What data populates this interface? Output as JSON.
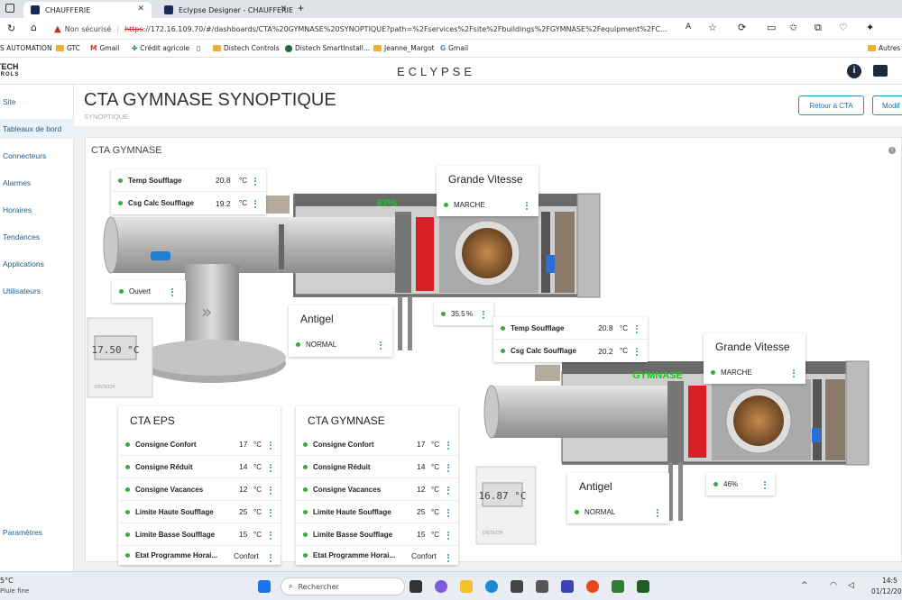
{
  "browser": {
    "tabs": [
      {
        "label": "CHAUFFERIE"
      },
      {
        "label": "Eclypse Designer - CHAUFFERIE"
      }
    ],
    "security_label": "Non sécurisé",
    "url_scheme": "https",
    "url_rest": "://172.16.109.70/#/dashboards/CTA%20GYMNASE%20SYNOPTIQUE?path=%2Fservices%2Fsite%2Fbuildings%2FGYMNASE%2Fequipment%2FC...",
    "bookmarks": [
      "S AUTOMATION",
      "GTC",
      "Gmail",
      "Crédit agricole",
      "Distech Controls",
      "Distech SmartInstall...",
      "Jeanne_Margot",
      "Gmail"
    ],
    "other_bookmarks": "Autres"
  },
  "app": {
    "brand_line1": "TECH",
    "brand_line2": "TROLS",
    "logo": "ECLYPSE"
  },
  "sidebar": {
    "items": [
      "Site",
      "Tableaux de bord",
      "Connecteurs",
      "Alarmes",
      "Horaires",
      "Tendances",
      "Applications",
      "Utilisateurs"
    ],
    "bottom": "Paramètres"
  },
  "page": {
    "title": "CTA GYMNASE SYNOPTIQUE",
    "subtitle": "SYNOPTIQUE",
    "back_button": "Retour à CTA",
    "modify_button": "Modif"
  },
  "content": {
    "title": "CTA GYMNASE",
    "info_icon": "info-icon",
    "eps_label": "EPS",
    "gymnase_label": "GYMNASE",
    "thermostat1": "17.50 °C",
    "thermostat2": "16.87 °C",
    "brand_small": "DISTECH"
  },
  "top_card": {
    "rows": [
      {
        "label": "Temp Soufflage",
        "value": "20.8",
        "unit": "°C"
      },
      {
        "label": "Csg Calc Soufflage",
        "value": "19.2",
        "unit": "°C"
      }
    ]
  },
  "ouvert_card": {
    "value": "Ouvert"
  },
  "gv1": {
    "title": "Grande Vitesse",
    "value": "MARCHE"
  },
  "antigel1": {
    "title": "Antigel",
    "value": "NORMAL"
  },
  "valve1": {
    "value": "35.5",
    "unit": "%"
  },
  "mid_card": {
    "rows": [
      {
        "label": "Temp Soufflage",
        "value": "20.8",
        "unit": "°C"
      },
      {
        "label": "Csg Calc Soufflage",
        "value": "20.2",
        "unit": "°C"
      }
    ]
  },
  "gv2": {
    "title": "Grande Vitesse",
    "value": "MARCHE"
  },
  "antigel2": {
    "title": "Antigel",
    "value": "NORMAL"
  },
  "valve2": {
    "value": "46",
    "unit": "%"
  },
  "cta_eps": {
    "title": "CTA EPS",
    "rows": [
      {
        "label": "Consigne Confort",
        "value": "17",
        "unit": "°C"
      },
      {
        "label": "Consigne Réduit",
        "value": "14",
        "unit": "°C"
      },
      {
        "label": "Consigne Vacances",
        "value": "12",
        "unit": "°C"
      },
      {
        "label": "Limite Haute Soufflage",
        "value": "25",
        "unit": "°C"
      },
      {
        "label": "Limite Basse Soufflage",
        "value": "15",
        "unit": "°C"
      },
      {
        "label": "Etat Programme Horai...",
        "value": "Confort",
        "unit": ""
      }
    ]
  },
  "cta_gym": {
    "title": "CTA GYMNASE",
    "rows": [
      {
        "label": "Consigne Confort",
        "value": "17",
        "unit": "°C"
      },
      {
        "label": "Consigne Réduit",
        "value": "14",
        "unit": "°C"
      },
      {
        "label": "Consigne Vacances",
        "value": "12",
        "unit": "°C"
      },
      {
        "label": "Limite Haute Soufflage",
        "value": "25",
        "unit": "°C"
      },
      {
        "label": "Limite Basse Soufflage",
        "value": "15",
        "unit": "°C"
      },
      {
        "label": "Etat Programme Horai...",
        "value": "Confort",
        "unit": ""
      }
    ]
  },
  "taskbar": {
    "weather_temp": "5°C",
    "weather_desc": "Pluie fine",
    "search_label": "Rechercher",
    "time": "14:5",
    "date": "01/12/202"
  }
}
